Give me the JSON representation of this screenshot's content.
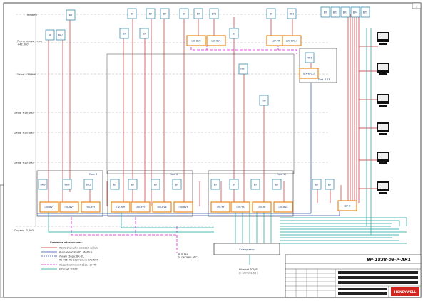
{
  "sheet": {
    "number": "1"
  },
  "levels": [
    {
      "label": "Кровля"
    },
    {
      "label": "Технический этаж\n+42,600"
    },
    {
      "label": "Этаж +39,900"
    },
    {
      "label": "Этаж +36,600"
    },
    {
      "label": "Этаж +33,300"
    },
    {
      "label": "Этаж +30,000"
    },
    {
      "label": "Подвал -3,600"
    }
  ],
  "devices": {
    "d1": "ВК",
    "d2": "ВК",
    "d3": "ВК-1",
    "d4": "ВУ",
    "d5": "ВУ2",
    "d6": "ВУ3",
    "d7": "ВУ4",
    "d8": "ВУ5",
    "d9": "ВУ",
    "d10": "ВУ",
    "d11": "ВУ",
    "d12": "ВУ",
    "d13": "ВУ",
    "d14": "ВУ",
    "d15": "ВУ",
    "d16": "ВУ1",
    "d17": "ВУ",
    "d18": "ВУ",
    "d19": "ВУ1",
    "d20": "ВУ2",
    "d21": "ВКЭ",
    "d22": "ВКЭ",
    "d23": "ВКЭ",
    "d24": "ПП1",
    "d25": "ПП1",
    "d26": "ВУ1",
    "d27": "ВУ2",
    "d28": "ВУ",
    "d29": "ВУ",
    "d30": "ВУ",
    "d31": "ВУ",
    "d32": "ВУ",
    "d33": "ВУ",
    "d34": "ВУ",
    "d35": "ВУ",
    "d36": "ПН",
    "d37": "ВУ",
    "d38": "ВУ"
  },
  "controllers": {
    "c1": "ШУ-ВУ1",
    "c2": "ШУ-ВУ2",
    "c3": "ШУ-ВУ1",
    "c4": "ШУ-ВУ2",
    "c5": "ШУ-ВУ1",
    "c6": "ШУ-ПТ",
    "c7": "ШУ-ВУ2.1",
    "c8": "ШУ-ВУ2.2",
    "c9": "ШУ-ПП1",
    "c10": "ШУ-ВУ2",
    "c11": "ШУ-ВУ4",
    "c12": "ШУ-ВУ1",
    "c13": "ШУ-ТЗ",
    "c14": "ШУ-ТВ",
    "c15": "ШУ-ТВ",
    "c16": "ШУ-ВУ4",
    "c17": "ШУ-В"
  },
  "groups": {
    "g1": "Пом. 3",
    "g2": "Пом. 8",
    "g3": "Пом. 12",
    "g4": "Пом. 4.23"
  },
  "hub": {
    "label": "Коммутатор"
  },
  "notes": {
    "n1": "АПС №2\n(к системе АПС)",
    "n2": "Ethernet TCP/IP\n(к системе СС )"
  },
  "legend": {
    "title": "Условные обозначения:",
    "items": [
      {
        "text": "Контрольный и силовой кабели",
        "color": "#c8282d"
      },
      {
        "text": "Интерфейс RS485, ModBus",
        "color": "#2a4fa8"
      },
      {
        "text": "Линия сбора: ВК-ВУ,",
        "color": "#2a4fa8"
      },
      {
        "text": "RS-485, RS-232 только BAC-NET",
        "color": "#2a4fa8"
      },
      {
        "text": "Аварийная линия сбора от ПТ",
        "color": "#e01bd8"
      },
      {
        "text": "Ethernet TCP/IP",
        "color": "#14a39a"
      }
    ]
  },
  "titleblock": {
    "code": "ВР-1838-03-Р-АК1",
    "logo": "HONEYWELL"
  },
  "colors": {
    "red": "#c8282d",
    "blue": "#2a4fa8",
    "magenta": "#e01bd8",
    "teal": "#14a39a",
    "orange": "#e8881a",
    "device": "#3a8fb0"
  }
}
